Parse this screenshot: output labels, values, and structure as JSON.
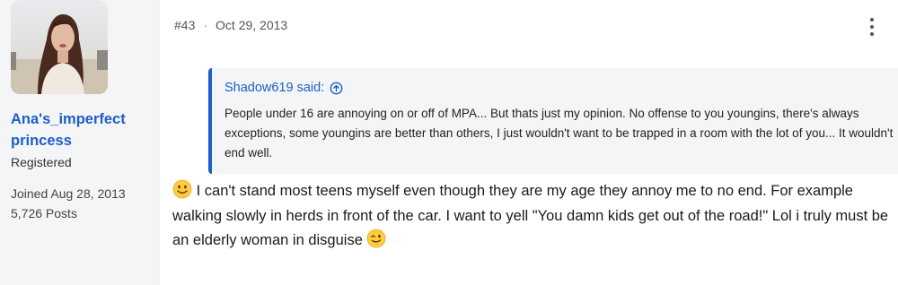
{
  "user": {
    "name": "Ana's_imperfect princess",
    "title": "Registered",
    "joined": "Joined Aug 28, 2013",
    "posts": "5,726 Posts"
  },
  "post": {
    "number": "#43",
    "date": "Oct 29, 2013",
    "quote": {
      "author": "Shadow619 said:",
      "text": "People under 16 are annoying on or off of MPA... But thats just my opinion. No offense to you youngins, there's always exceptions, some youngins are better than others, I just wouldn't want to be trapped in a room with the lot of you... It wouldn't end well."
    },
    "body_main": "I can't stand most teens myself even though they are my age they annoy me to no end. For example walking slowly in herds in front of the car. I want to yell \"You damn kids get out of the road!\" Lol i truly must be an elderly woman in disguise",
    "emojis": [
      "smile-emoji",
      "wink-emoji"
    ]
  },
  "icons": {
    "more": "more-vertical-icon",
    "quote_jump": "arrow-up-circle-icon"
  },
  "colors": {
    "accent": "#1d5ec9",
    "sidebar_bg": "#f4f5f7",
    "quote_bg": "#f4f5f7"
  }
}
